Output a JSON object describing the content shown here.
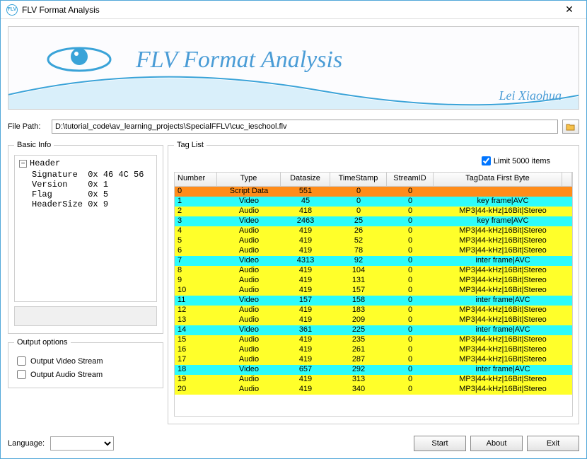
{
  "window": {
    "title": "FLV Format Analysis"
  },
  "banner": {
    "title": "FLV Format Analysis",
    "author": "Lei Xiaohua"
  },
  "filepath": {
    "label": "File Path:",
    "value": "D:\\tutorial_code\\av_learning_projects\\SpecialFFLV\\cuc_ieschool.flv"
  },
  "basic_info": {
    "legend": "Basic Info",
    "root": "Header",
    "rows": [
      {
        "k": "Signature",
        "v": "0x 46 4C 56"
      },
      {
        "k": "Version",
        "v": "0x 1"
      },
      {
        "k": "Flag",
        "v": "0x 5"
      },
      {
        "k": "HeaderSize",
        "v": "0x 9"
      }
    ]
  },
  "output": {
    "legend": "Output options",
    "video": "Output Video Stream",
    "audio": "Output Audio Stream"
  },
  "taglist": {
    "legend": "Tag List",
    "limit_label": "Limit 5000 items",
    "headers": [
      "Number",
      "Type",
      "Datasize",
      "TimeStamp",
      "StreamID",
      "TagData First Byte"
    ],
    "rows": [
      {
        "n": 0,
        "type": "Script Data",
        "size": 551,
        "ts": 0,
        "sid": 0,
        "first": "",
        "cls": "script"
      },
      {
        "n": 1,
        "type": "Video",
        "size": 45,
        "ts": 0,
        "sid": 0,
        "first": "key frame|AVC",
        "cls": "video"
      },
      {
        "n": 2,
        "type": "Audio",
        "size": 418,
        "ts": 0,
        "sid": 0,
        "first": "MP3|44-kHz|16Bit|Stereo",
        "cls": "audio"
      },
      {
        "n": 3,
        "type": "Video",
        "size": 2463,
        "ts": 25,
        "sid": 0,
        "first": "key frame|AVC",
        "cls": "video"
      },
      {
        "n": 4,
        "type": "Audio",
        "size": 419,
        "ts": 26,
        "sid": 0,
        "first": "MP3|44-kHz|16Bit|Stereo",
        "cls": "audio"
      },
      {
        "n": 5,
        "type": "Audio",
        "size": 419,
        "ts": 52,
        "sid": 0,
        "first": "MP3|44-kHz|16Bit|Stereo",
        "cls": "audio"
      },
      {
        "n": 6,
        "type": "Audio",
        "size": 419,
        "ts": 78,
        "sid": 0,
        "first": "MP3|44-kHz|16Bit|Stereo",
        "cls": "audio"
      },
      {
        "n": 7,
        "type": "Video",
        "size": 4313,
        "ts": 92,
        "sid": 0,
        "first": "inter frame|AVC",
        "cls": "video"
      },
      {
        "n": 8,
        "type": "Audio",
        "size": 419,
        "ts": 104,
        "sid": 0,
        "first": "MP3|44-kHz|16Bit|Stereo",
        "cls": "audio"
      },
      {
        "n": 9,
        "type": "Audio",
        "size": 419,
        "ts": 131,
        "sid": 0,
        "first": "MP3|44-kHz|16Bit|Stereo",
        "cls": "audio"
      },
      {
        "n": 10,
        "type": "Audio",
        "size": 419,
        "ts": 157,
        "sid": 0,
        "first": "MP3|44-kHz|16Bit|Stereo",
        "cls": "audio"
      },
      {
        "n": 11,
        "type": "Video",
        "size": 157,
        "ts": 158,
        "sid": 0,
        "first": "inter frame|AVC",
        "cls": "video"
      },
      {
        "n": 12,
        "type": "Audio",
        "size": 419,
        "ts": 183,
        "sid": 0,
        "first": "MP3|44-kHz|16Bit|Stereo",
        "cls": "audio"
      },
      {
        "n": 13,
        "type": "Audio",
        "size": 419,
        "ts": 209,
        "sid": 0,
        "first": "MP3|44-kHz|16Bit|Stereo",
        "cls": "audio"
      },
      {
        "n": 14,
        "type": "Video",
        "size": 361,
        "ts": 225,
        "sid": 0,
        "first": "inter frame|AVC",
        "cls": "video"
      },
      {
        "n": 15,
        "type": "Audio",
        "size": 419,
        "ts": 235,
        "sid": 0,
        "first": "MP3|44-kHz|16Bit|Stereo",
        "cls": "audio"
      },
      {
        "n": 16,
        "type": "Audio",
        "size": 419,
        "ts": 261,
        "sid": 0,
        "first": "MP3|44-kHz|16Bit|Stereo",
        "cls": "audio"
      },
      {
        "n": 17,
        "type": "Audio",
        "size": 419,
        "ts": 287,
        "sid": 0,
        "first": "MP3|44-kHz|16Bit|Stereo",
        "cls": "audio"
      },
      {
        "n": 18,
        "type": "Video",
        "size": 657,
        "ts": 292,
        "sid": 0,
        "first": "inter frame|AVC",
        "cls": "video"
      },
      {
        "n": 19,
        "type": "Audio",
        "size": 419,
        "ts": 313,
        "sid": 0,
        "first": "MP3|44-kHz|16Bit|Stereo",
        "cls": "audio"
      },
      {
        "n": 20,
        "type": "Audio",
        "size": 419,
        "ts": 340,
        "sid": 0,
        "first": "MP3|44-kHz|16Bit|Stereo",
        "cls": "audio"
      }
    ]
  },
  "language": {
    "label": "Language:",
    "value": ""
  },
  "buttons": {
    "start": "Start",
    "about": "About",
    "exit": "Exit"
  }
}
